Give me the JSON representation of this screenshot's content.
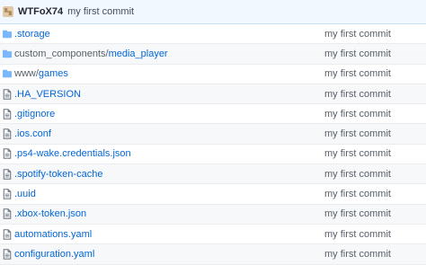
{
  "commit": {
    "author": "WTFoX74",
    "message": "my first commit"
  },
  "files": [
    {
      "type": "folder",
      "prefix": "",
      "name": ".storage",
      "message": "my first commit"
    },
    {
      "type": "folder",
      "prefix": "custom_components/",
      "name": "media_player",
      "message": "my first commit"
    },
    {
      "type": "folder",
      "prefix": "www/",
      "name": "games",
      "message": "my first commit"
    },
    {
      "type": "file",
      "prefix": "",
      "name": ".HA_VERSION",
      "message": "my first commit"
    },
    {
      "type": "file",
      "prefix": "",
      "name": ".gitignore",
      "message": "my first commit"
    },
    {
      "type": "file",
      "prefix": "",
      "name": ".ios.conf",
      "message": "my first commit"
    },
    {
      "type": "file",
      "prefix": "",
      "name": ".ps4-wake.credentials.json",
      "message": "my first commit"
    },
    {
      "type": "file",
      "prefix": "",
      "name": ".spotify-token-cache",
      "message": "my first commit"
    },
    {
      "type": "file",
      "prefix": "",
      "name": ".uuid",
      "message": "my first commit"
    },
    {
      "type": "file",
      "prefix": "",
      "name": ".xbox-token.json",
      "message": "my first commit"
    },
    {
      "type": "file",
      "prefix": "",
      "name": "automations.yaml",
      "message": "my first commit"
    },
    {
      "type": "file",
      "prefix": "",
      "name": "configuration.yaml",
      "message": "my first commit"
    }
  ]
}
